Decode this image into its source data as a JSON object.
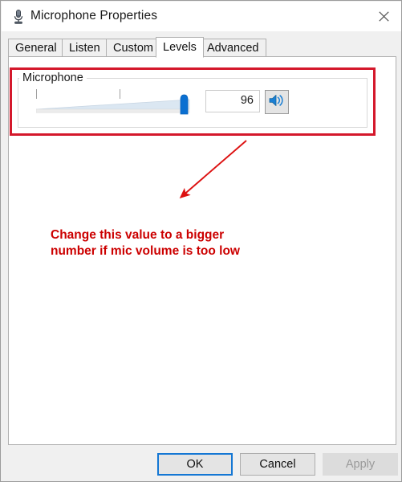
{
  "window": {
    "title": "Microphone Properties",
    "title_icon": "microphone-icon",
    "close_icon": "close-icon"
  },
  "tabs": [
    {
      "label": "General",
      "selected": false
    },
    {
      "label": "Listen",
      "selected": false
    },
    {
      "label": "Custom",
      "selected": false
    },
    {
      "label": "Levels",
      "selected": true
    },
    {
      "label": "Advanced",
      "selected": false
    }
  ],
  "levels_tab": {
    "group": {
      "label": "Microphone",
      "slider": {
        "value": 96,
        "min": 0,
        "max": 100,
        "tick_positions": [
          0,
          50,
          100
        ]
      },
      "value_field": {
        "value": "96",
        "placeholder": "0"
      },
      "mute_button": {
        "icon": "speaker-on-icon",
        "state": "unmuted"
      }
    }
  },
  "annotation": {
    "line1": "Change this value to a bigger",
    "line2": "number if mic volume is too low",
    "color": "#cc0000",
    "arrow_icon": "arrow-down-left-icon"
  },
  "footer": {
    "ok_label": "OK",
    "cancel_label": "Cancel",
    "apply_label": "Apply",
    "apply_disabled": true
  },
  "colors": {
    "accent": "#0078d7",
    "annotation_red": "#cc0000",
    "highlight_border": "#d4182b",
    "window_bg": "#f0f0f0",
    "panel_bg": "#ffffff"
  }
}
